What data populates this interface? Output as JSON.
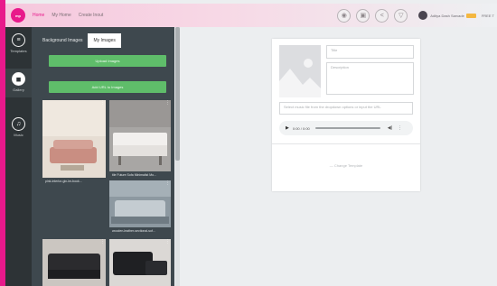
{
  "topbar": {
    "logo_text": "mp",
    "nav": [
      "Home",
      "My Home",
      "Create Inout"
    ],
    "round_buttons": [
      {
        "icon": "eye-icon",
        "glyph": "◉"
      },
      {
        "icon": "save-icon",
        "glyph": "▣"
      },
      {
        "icon": "share-icon",
        "glyph": "<"
      },
      {
        "icon": "download-icon",
        "glyph": "▽"
      }
    ],
    "user_name": "Aditya Dash Sarvade",
    "free_text": "FREE T"
  },
  "rail": {
    "items": [
      {
        "name": "templates",
        "label": "Templates",
        "icon": "menu-icon",
        "glyph": "≡"
      },
      {
        "name": "gallery",
        "label": "Gallery",
        "icon": "camera-icon",
        "glyph": "◼"
      },
      {
        "name": "music",
        "label": "Music",
        "icon": "music-note-icon",
        "glyph": "♫"
      }
    ]
  },
  "panel": {
    "tabs": [
      "Background Images",
      "My Images"
    ],
    "upload_label": "Upload Images",
    "add_url_label": "Add URL to Images",
    "thumbs": [
      {
        "caption": "pink-interior-gin-im-book...",
        "colors": [
          "#e6d9cd",
          "#c98e82"
        ]
      },
      {
        "caption": "tile Future Sofa Minimalist Mo...",
        "colors": [
          "#a9a6a3",
          "#f2f0ee"
        ]
      },
      {
        "caption": "wooden-leather-sectional-sof...",
        "colors": [
          "#7d8a93",
          "#b8c2c8"
        ]
      },
      {
        "caption": "",
        "colors": [
          "#c9c5c1",
          "#2b2b2e"
        ]
      },
      {
        "caption": "",
        "colors": [
          "#d9d6d3",
          "#1f2023"
        ]
      }
    ]
  },
  "card": {
    "title_placeholder": "Title",
    "description_placeholder": "Description",
    "music_placeholder": "Select music file from the dropdown options or input the URL",
    "time": "0:00 / 0:00",
    "change_template": "— Change Template"
  }
}
